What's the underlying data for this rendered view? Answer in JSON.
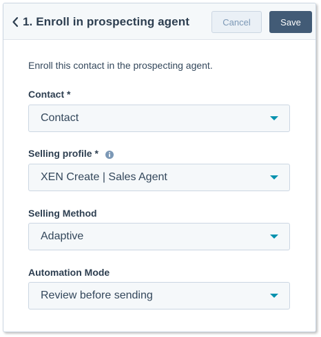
{
  "header": {
    "back_icon": "chevron-left-icon",
    "title": "1. Enroll in prospecting agent",
    "cancel_label": "Cancel",
    "save_label": "Save"
  },
  "form": {
    "description": "Enroll this contact in the prospecting agent.",
    "fields": [
      {
        "label": "Contact *",
        "value": "Contact"
      },
      {
        "label": "Selling profile *",
        "value": "XEN Create | Sales Agent",
        "info_icon": "info-icon"
      },
      {
        "label": "Selling Method",
        "value": "Adaptive"
      },
      {
        "label": "Automation Mode",
        "value": "Review before sending"
      }
    ]
  },
  "colors": {
    "header_bg": "#f5f8fa",
    "save_bg": "#425b76",
    "caret": "#0091ae",
    "info_icon": "#7c98b6"
  }
}
